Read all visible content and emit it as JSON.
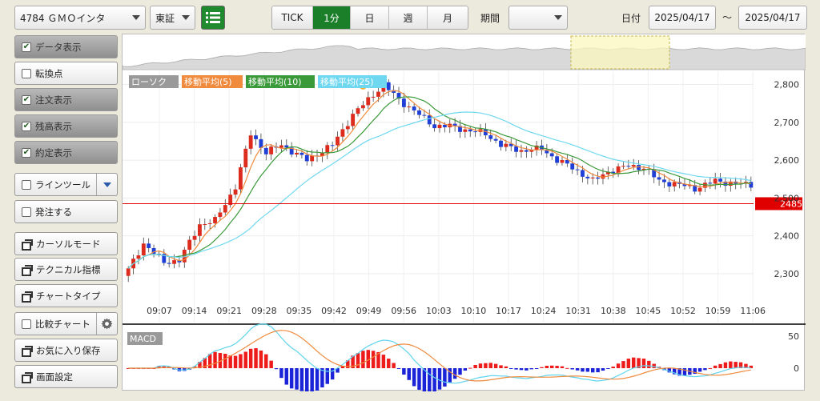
{
  "toolbar": {
    "stock": "4784 ＧＭＯインタ",
    "market": "東証",
    "tabs": [
      {
        "label": "TICK",
        "active": false
      },
      {
        "label": "1分",
        "active": true
      },
      {
        "label": "日",
        "active": false
      },
      {
        "label": "週",
        "active": false
      },
      {
        "label": "月",
        "active": false
      }
    ],
    "period_label": "期間",
    "period_value": "",
    "date_label": "日付",
    "date_from": "2025/04/17",
    "date_sep": "〜",
    "date_to": "2025/04/17"
  },
  "sidebar": [
    {
      "label": "データ表示",
      "type": "check",
      "checked": true,
      "on": true
    },
    {
      "label": "転換点",
      "type": "check",
      "checked": false,
      "on": false
    },
    {
      "label": "注文表示",
      "type": "check",
      "checked": true,
      "on": true
    },
    {
      "label": "残高表示",
      "type": "check",
      "checked": true,
      "on": true
    },
    {
      "label": "約定表示",
      "type": "check",
      "checked": true,
      "on": true
    },
    {
      "label": "ラインツール",
      "type": "check-drop",
      "checked": false,
      "on": false
    },
    {
      "label": "発注する",
      "type": "check",
      "checked": false,
      "on": false
    },
    {
      "label": "カーソルモード",
      "type": "win"
    },
    {
      "label": "テクニカル指標",
      "type": "win"
    },
    {
      "label": "チャートタイプ",
      "type": "win"
    },
    {
      "label": "比較チャート",
      "type": "check-gear",
      "checked": false,
      "on": false
    },
    {
      "label": "お気に入り保存",
      "type": "win"
    },
    {
      "label": "画面設定",
      "type": "win"
    }
  ],
  "chart_data": {
    "type": "candlestick",
    "legend": [
      {
        "label": "ローソク",
        "color": "#999999"
      },
      {
        "label": "移動平均(5)",
        "color": "#f08a3c"
      },
      {
        "label": "移動平均(10)",
        "color": "#3a9a3a"
      },
      {
        "label": "移動平均(25)",
        "color": "#6fd8f0"
      }
    ],
    "x_tick_labels": [
      "09:07",
      "09:14",
      "09:21",
      "09:28",
      "09:35",
      "09:42",
      "09:49",
      "09:56",
      "10:03",
      "10:10",
      "10:17",
      "10:24",
      "10:31",
      "10:38",
      "10:45",
      "10:52",
      "10:59",
      "11:06"
    ],
    "y_ticks": [
      2300,
      2400,
      2500,
      2600,
      2700,
      2800
    ],
    "y_tick_labels": [
      "2,300",
      "2,400",
      "2,500",
      "2,600",
      "2,700",
      "2,800"
    ],
    "ylim": [
      2230,
      2835
    ],
    "order_line": {
      "value": 2485,
      "label": "2485",
      "color": "#e00000"
    },
    "close_path": [
      [
        0,
        2310
      ],
      [
        3,
        2380
      ],
      [
        7,
        2330
      ],
      [
        10,
        2335
      ],
      [
        14,
        2430
      ],
      [
        17,
        2440
      ],
      [
        21,
        2530
      ],
      [
        24,
        2670
      ],
      [
        27,
        2620
      ],
      [
        30,
        2640
      ],
      [
        35,
        2600
      ],
      [
        40,
        2640
      ],
      [
        44,
        2720
      ],
      [
        47,
        2760
      ],
      [
        50,
        2800
      ],
      [
        53,
        2760
      ],
      [
        56,
        2730
      ],
      [
        60,
        2690
      ],
      [
        63,
        2690
      ],
      [
        66,
        2680
      ],
      [
        70,
        2670
      ],
      [
        73,
        2640
      ],
      [
        77,
        2625
      ],
      [
        81,
        2630
      ],
      [
        84,
        2600
      ],
      [
        87,
        2580
      ],
      [
        91,
        2545
      ],
      [
        94,
        2570
      ],
      [
        98,
        2585
      ],
      [
        101,
        2580
      ],
      [
        104,
        2545
      ],
      [
        108,
        2535
      ],
      [
        111,
        2525
      ],
      [
        115,
        2545
      ],
      [
        118,
        2540
      ],
      [
        121,
        2535
      ]
    ],
    "macd": {
      "label": "MACD",
      "y_tick_labels": [
        "50",
        "0"
      ]
    }
  }
}
